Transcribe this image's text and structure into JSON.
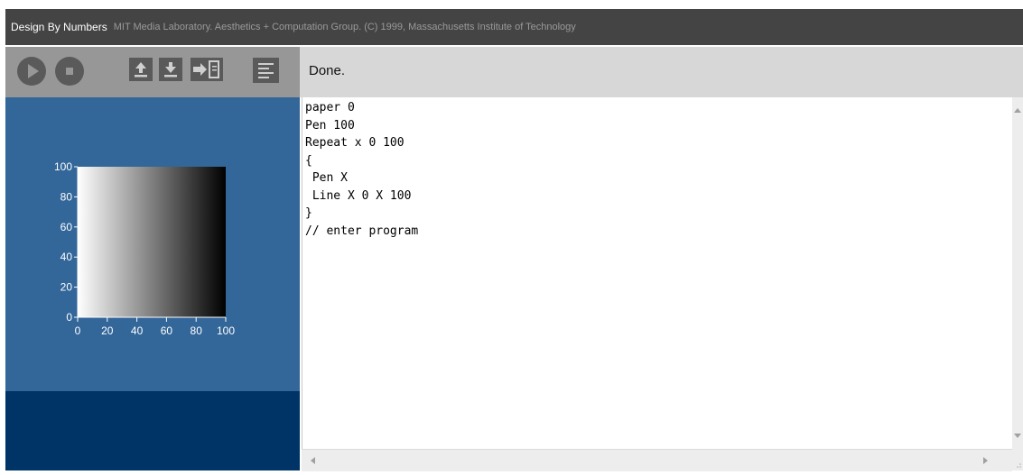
{
  "titlebar": {
    "app_name": "Design By Numbers",
    "credits": "MIT Media Laboratory. Aesthetics + Computation Group. (C) 1999, Massachusetts Institute of Technology"
  },
  "toolbar": {
    "buttons": [
      {
        "name": "run",
        "icon": "play-icon"
      },
      {
        "name": "stop",
        "icon": "stop-icon"
      },
      {
        "name": "open",
        "icon": "upload-icon"
      },
      {
        "name": "save",
        "icon": "download-icon"
      },
      {
        "name": "export",
        "icon": "insert-icon"
      },
      {
        "name": "print",
        "icon": "document-lines-icon"
      }
    ]
  },
  "status": {
    "text": "Done."
  },
  "canvas": {
    "y_ticks": [
      "100",
      "80",
      "60",
      "40",
      "20",
      "0"
    ],
    "x_ticks": [
      "0",
      "20",
      "40",
      "60",
      "80",
      "100"
    ],
    "gradient": {
      "from_gray": 0,
      "to_gray": 100
    }
  },
  "editor": {
    "code": "paper 0\nPen 100\nRepeat x 0 100\n{\n Pen X\n Line X 0 X 100\n}\n// enter program"
  },
  "colors": {
    "titlebar": "#444444",
    "toolbar": "#979797",
    "statusbar": "#d7d7d7",
    "canvas_panel": "#336699",
    "footer_panel": "#003366"
  }
}
